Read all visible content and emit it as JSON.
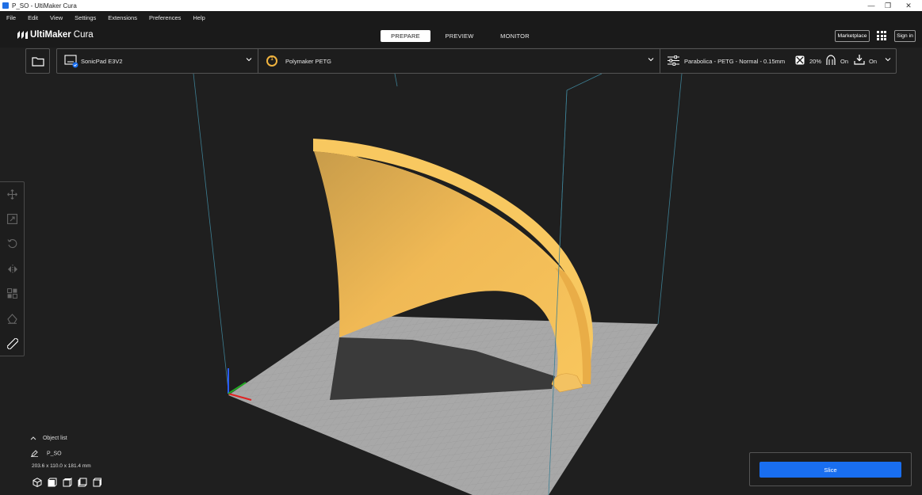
{
  "window": {
    "title": "P_SO - UltiMaker Cura",
    "controls": [
      "—",
      "❐",
      "✕"
    ]
  },
  "menu": [
    "File",
    "Edit",
    "View",
    "Settings",
    "Extensions",
    "Preferences",
    "Help"
  ],
  "brand": {
    "part1": "UltiMaker",
    "part2": "Cura"
  },
  "stages": {
    "prepare": "PREPARE",
    "preview": "PREVIEW",
    "monitor": "MONITOR"
  },
  "header": {
    "marketplace": "Marketplace",
    "signin": "Sign in"
  },
  "printer": {
    "name": "SonicPad E3V2"
  },
  "material": {
    "name": "Polymaker PETG",
    "extruder": "1"
  },
  "profile": {
    "name": "Parabolica - PETG - Normal - 0.15mm",
    "infill": "20%",
    "support": "On",
    "adhesion": "On"
  },
  "object_list": {
    "label": "Object list",
    "item": "P_SO",
    "dimensions": "203.6 x 110.0 x 181.4 mm"
  },
  "slice": {
    "label": "Slice"
  },
  "colors": {
    "accent": "#196ef0",
    "model": "#f6c257",
    "build_plate": "#a9a9a9",
    "background": "#1f1f1f"
  }
}
